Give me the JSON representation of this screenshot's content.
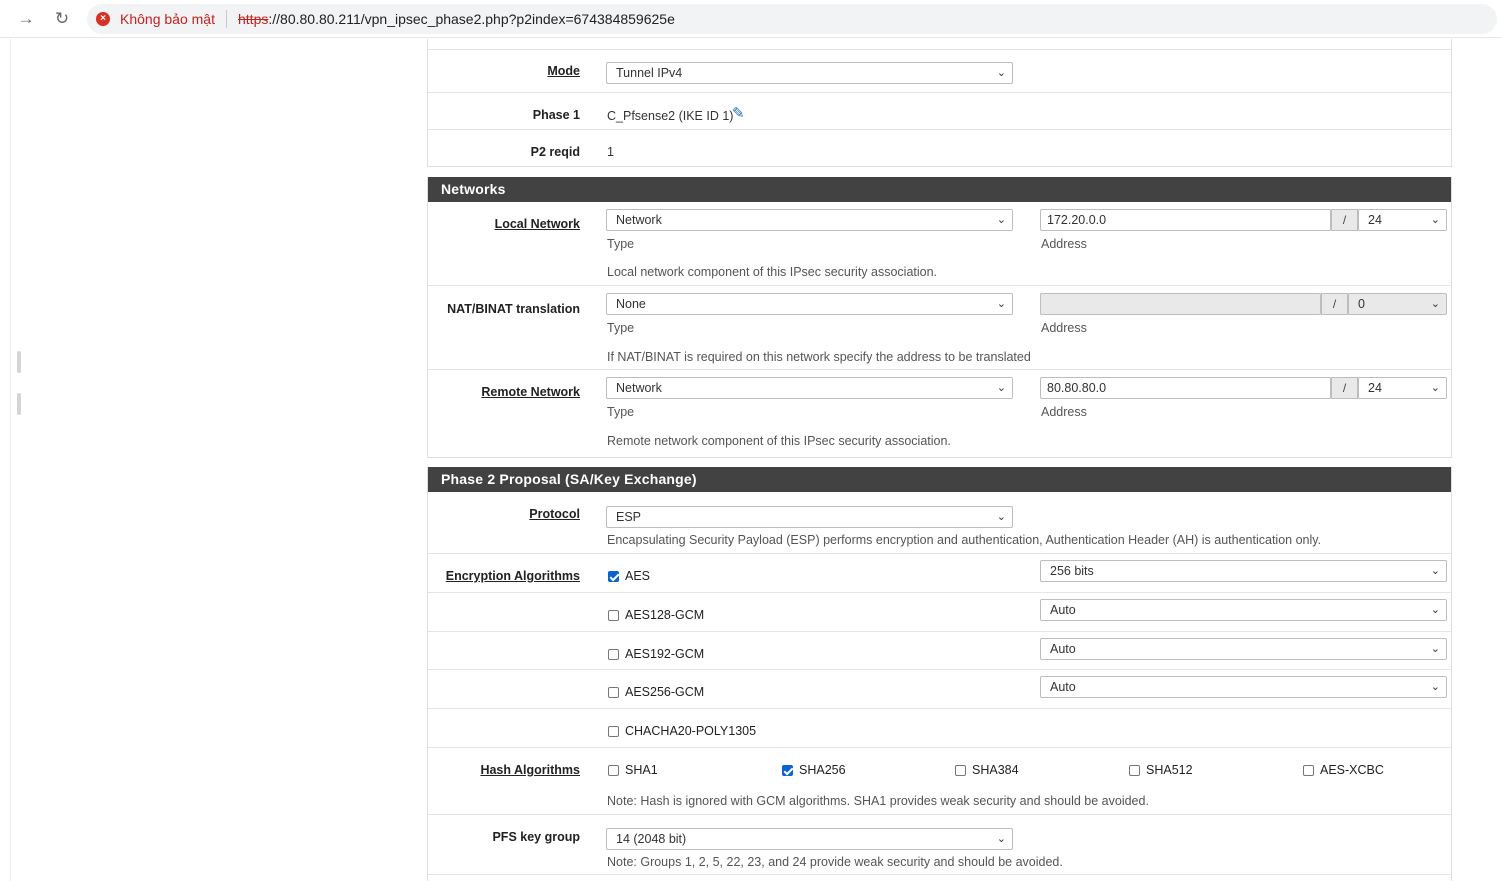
{
  "browser": {
    "security_label": "Không bảo mật",
    "url_scheme": "https",
    "url_rest": "://80.80.80.211/vpn_ipsec_phase2.php?p2index=674384859625e"
  },
  "general": {
    "mode_label": "Mode",
    "mode_value": "Tunnel IPv4",
    "phase1_label": "Phase 1",
    "phase1_value": "C_Pfsense2 (IKE ID 1)",
    "reqid_label": "P2 reqid",
    "reqid_value": "1"
  },
  "networks": {
    "title": "Networks",
    "type_caption": "Type",
    "address_caption": "Address",
    "slash": "/",
    "local": {
      "label": "Local Network",
      "type": "Network",
      "address": "172.20.0.0",
      "mask": "24",
      "hint": "Local network component of this IPsec security association."
    },
    "nat": {
      "label": "NAT/BINAT translation",
      "type": "None",
      "address": "",
      "mask": "0",
      "hint": "If NAT/BINAT is required on this network specify the address to be translated"
    },
    "remote": {
      "label": "Remote Network",
      "type": "Network",
      "address": "80.80.80.0",
      "mask": "24",
      "hint": "Remote network component of this IPsec security association."
    }
  },
  "proposal": {
    "title": "Phase 2 Proposal (SA/Key Exchange)",
    "protocol_label": "Protocol",
    "protocol_value": "ESP",
    "protocol_hint": "Encapsulating Security Payload (ESP) performs encryption and authentication, Authentication Header (AH) is authentication only.",
    "enc_label": "Encryption Algorithms",
    "enc": [
      {
        "name": "AES",
        "checked": true,
        "keylen": "256 bits"
      },
      {
        "name": "AES128-GCM",
        "checked": false,
        "keylen": "Auto"
      },
      {
        "name": "AES192-GCM",
        "checked": false,
        "keylen": "Auto"
      },
      {
        "name": "AES256-GCM",
        "checked": false,
        "keylen": "Auto"
      },
      {
        "name": "CHACHA20-POLY1305",
        "checked": false,
        "keylen": ""
      }
    ],
    "hash_label": "Hash Algorithms",
    "hash": [
      {
        "name": "SHA1",
        "checked": false
      },
      {
        "name": "SHA256",
        "checked": true
      },
      {
        "name": "SHA384",
        "checked": false
      },
      {
        "name": "SHA512",
        "checked": false
      },
      {
        "name": "AES-XCBC",
        "checked": false
      }
    ],
    "hash_hint": "Note: Hash is ignored with GCM algorithms. SHA1 provides weak security and should be avoided.",
    "pfs_label": "PFS key group",
    "pfs_value": "14 (2048 bit)",
    "pfs_hint": "Note: Groups 1, 2, 5, 22, 23, and 24 provide weak security and should be avoided."
  },
  "colors": {
    "panel_header": "#424242",
    "insecure_red": "#c5221f",
    "checkbox_blue": "#0b63ce",
    "edit_icon": "#1e6bb8"
  }
}
